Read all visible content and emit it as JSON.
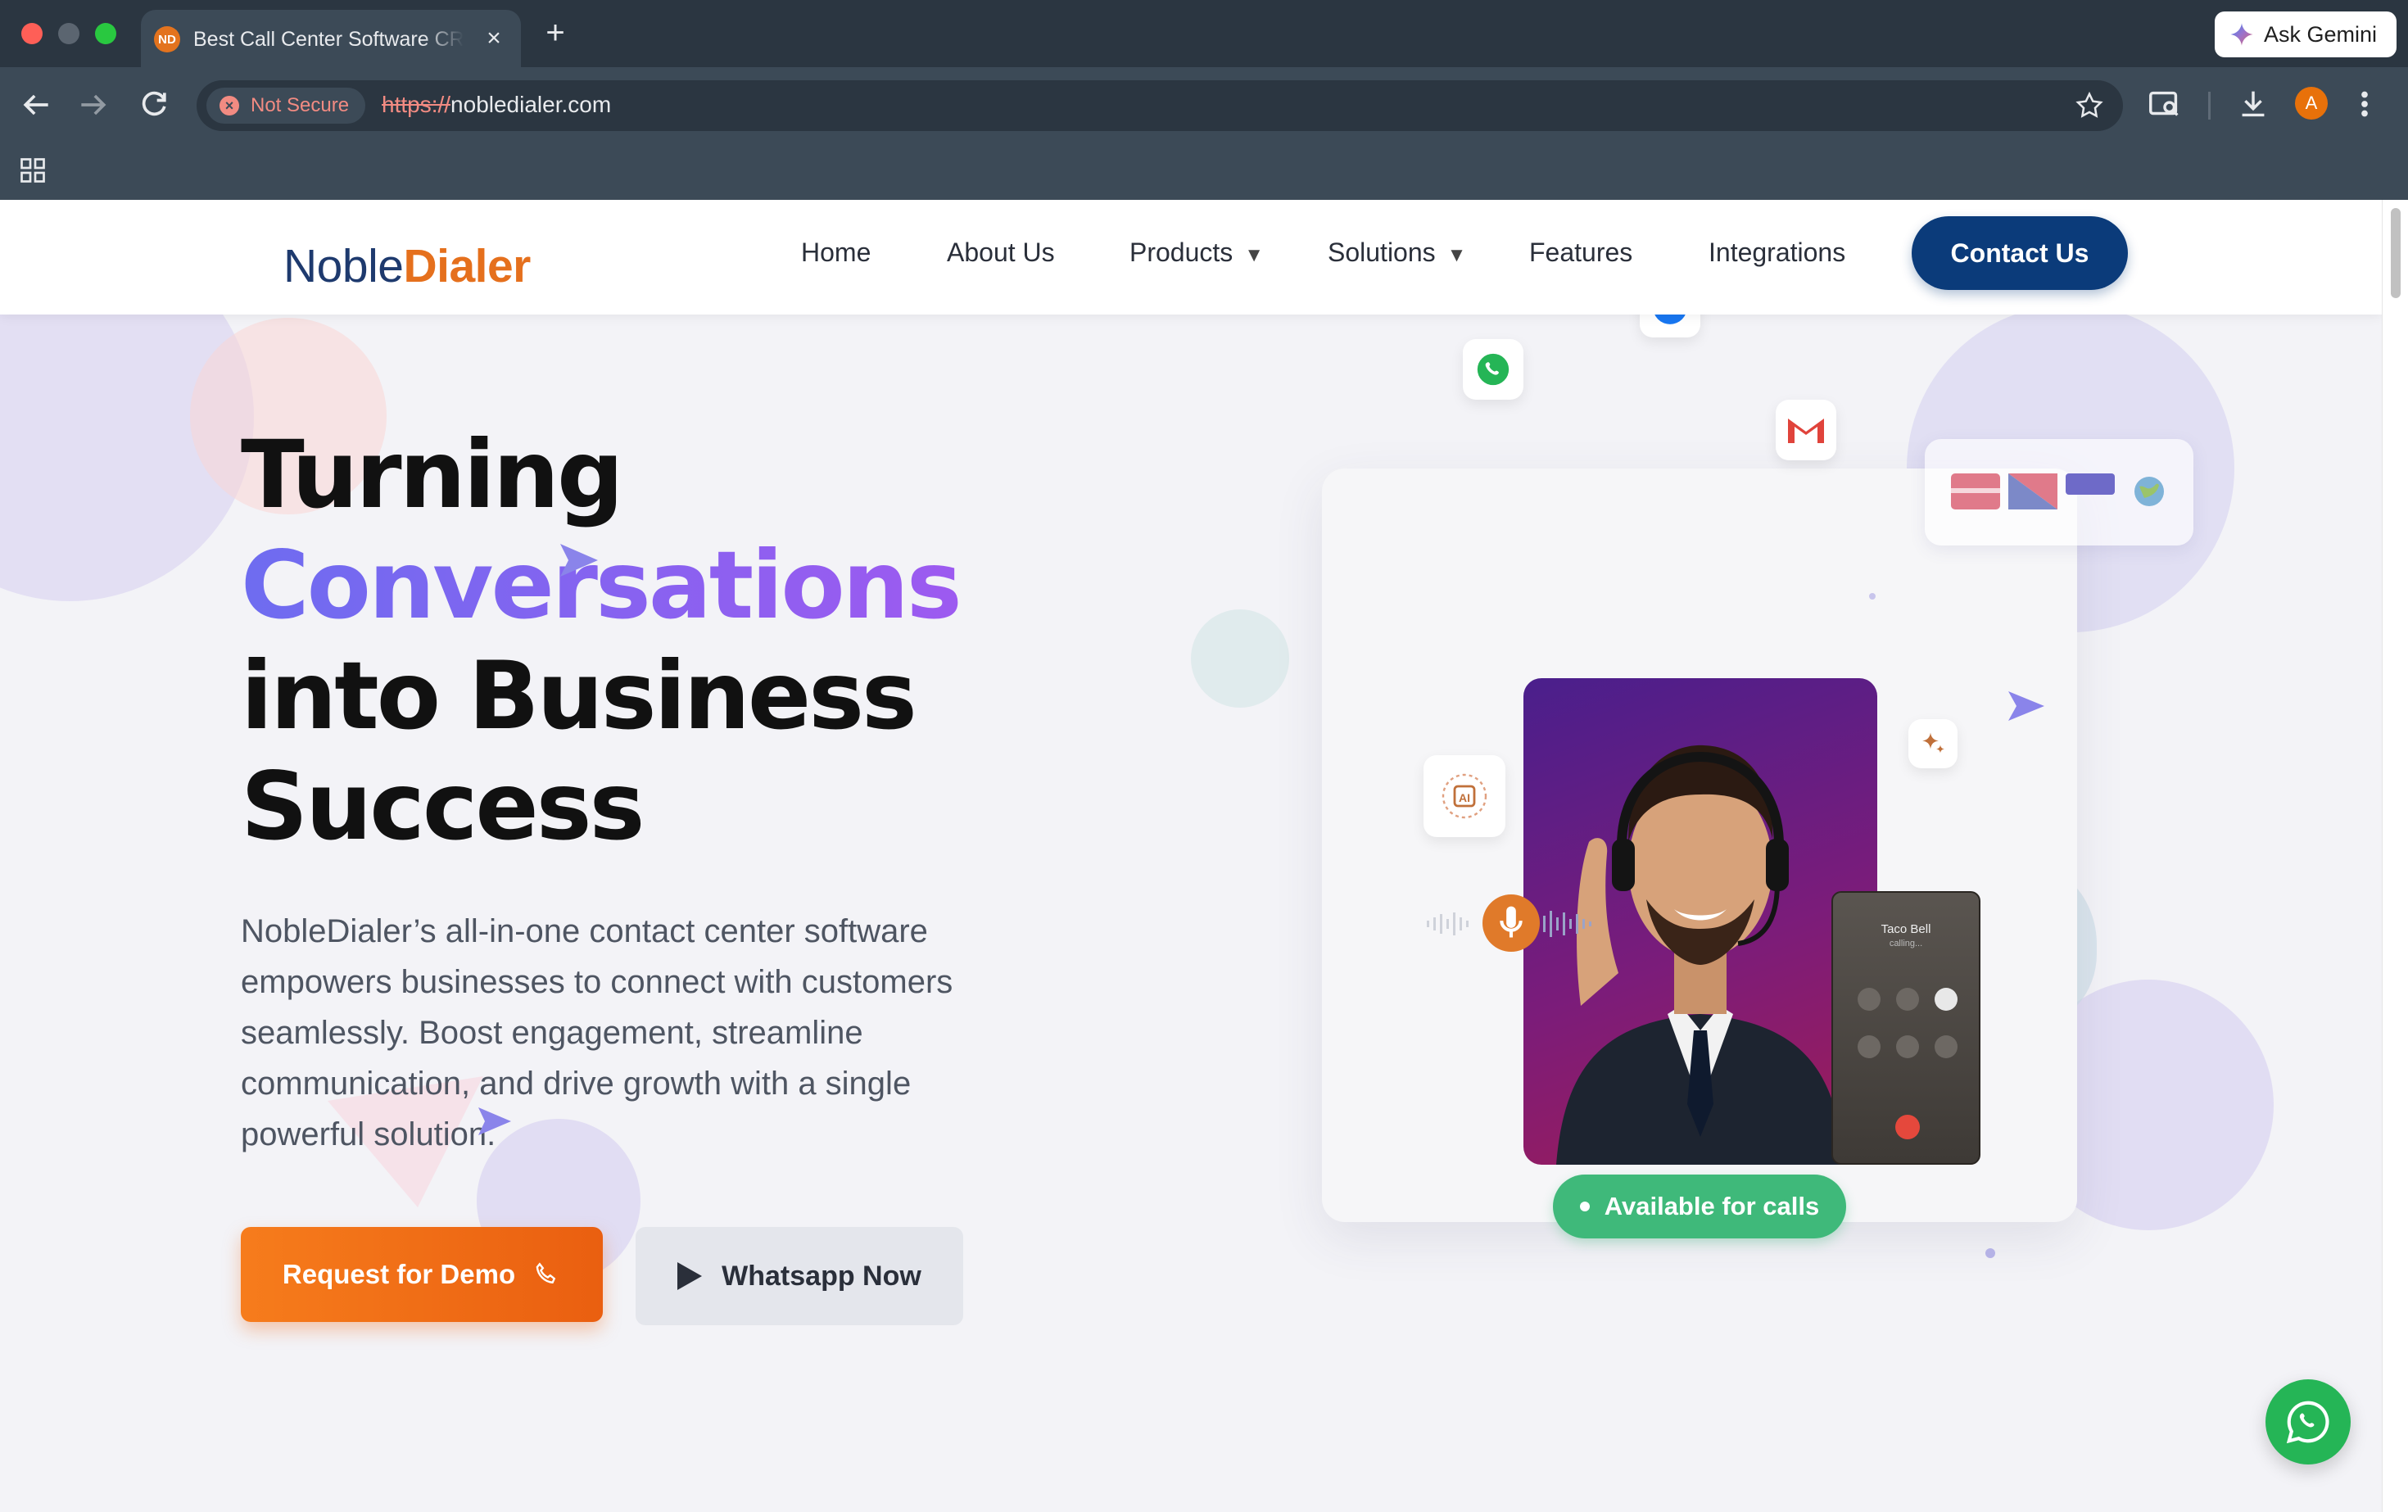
{
  "browser": {
    "tab_title": "Best Call Center Software CRM",
    "tab_favicon_text": "ND",
    "ask_gemini": "Ask Gemini",
    "security_label": "Not Secure",
    "url_scheme": "https://",
    "url_host": "nobledialer.com",
    "profile_initial": "A"
  },
  "header": {
    "logo_part1": "Noble",
    "logo_part2": "Dialer",
    "nav": {
      "home": "Home",
      "about": "About Us",
      "products": "Products",
      "solutions": "Solutions",
      "features": "Features",
      "integrations": "Integrations"
    },
    "contact": "Contact Us"
  },
  "hero": {
    "title_line1": "Turning",
    "title_line2": "Conversations",
    "title_line3": "into Business",
    "title_line4": "Success",
    "description": "NobleDialer’s all-in-one contact center software empowers businesses to connect with customers seamlessly. Boost engagement, streamline communication, and drive growth with a single powerful solution.",
    "demo_button": "Request for Demo",
    "whatsapp_button": "Whatsapp Now"
  },
  "visual": {
    "phone_caller": "Taco Bell",
    "phone_status": "calling...",
    "available_label": "Available for calls"
  },
  "colors": {
    "brand_navy": "#0b3b7a",
    "brand_orange": "#e5701d",
    "accent_purple": "#8a5cf0",
    "available_green": "#3fb97a",
    "whatsapp_green": "#25b556"
  }
}
